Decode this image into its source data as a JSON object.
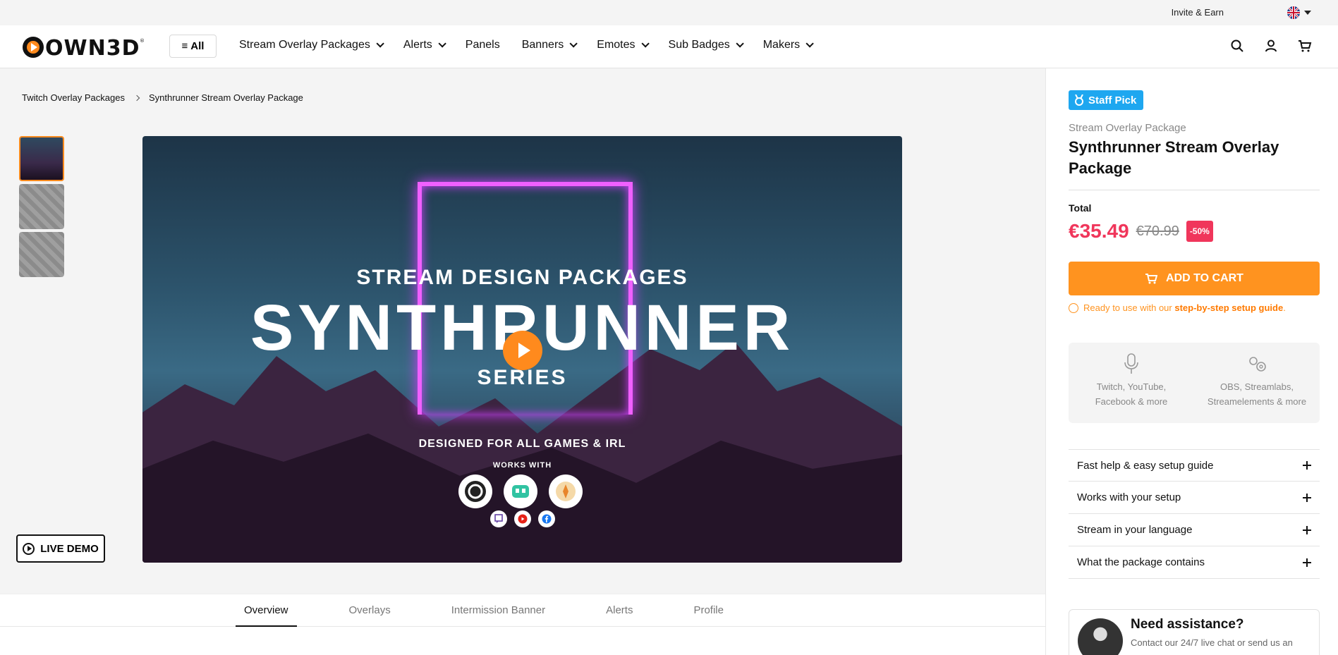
{
  "topbar": {
    "invite_label": "Invite & Earn",
    "language_icon": "uk-flag-icon"
  },
  "header": {
    "logo_text": "OWN3D",
    "all_label": "All",
    "nav": [
      {
        "label": "Stream Overlay Packages",
        "has_dropdown": true
      },
      {
        "label": "Alerts",
        "has_dropdown": true
      },
      {
        "label": "Panels",
        "has_dropdown": false
      },
      {
        "label": "Banners",
        "has_dropdown": true
      },
      {
        "label": "Emotes",
        "has_dropdown": true
      },
      {
        "label": "Sub Badges",
        "has_dropdown": true
      },
      {
        "label": "Makers",
        "has_dropdown": true
      }
    ],
    "icons": [
      "search-icon",
      "account-icon",
      "cart-icon"
    ]
  },
  "breadcrumb": {
    "parent": "Twitch Overlay Packages",
    "current": "Synthrunner Stream Overlay Package"
  },
  "hero": {
    "line1": "STREAM DESIGN PACKAGES",
    "title": "SYNTHRUNNER",
    "line2": "SERIES",
    "designed": "DESIGNED FOR ALL GAMES & IRL",
    "works_with": "WORKS WITH"
  },
  "live_demo_label": "LIVE DEMO",
  "tabs": [
    "Overview",
    "Overlays",
    "Intermission Banner",
    "Alerts",
    "Profile"
  ],
  "product": {
    "badge": "Staff Pick",
    "category": "Stream Overlay Package",
    "title": "Synthrunner Stream Overlay Package",
    "total_label": "Total",
    "price_now": "€35.49",
    "price_old": "€70.99",
    "discount": "-50%",
    "add_to_cart": "ADD TO CART",
    "ready_prefix": "Ready to use with our ",
    "ready_link": "step-by-step setup guide",
    "ready_suffix": ".",
    "compat": [
      {
        "icon": "microphone-icon",
        "line1": "Twitch, YouTube,",
        "line2": "Facebook & more"
      },
      {
        "icon": "gears-icon",
        "line1": "OBS, Streamlabs,",
        "line2": "Streamelements & more"
      }
    ],
    "accordion": [
      "Fast help & easy setup guide",
      "Works with your setup",
      "Stream in your language",
      "What the package contains"
    ],
    "assist_title": "Need assistance?",
    "assist_text": "Contact our 24/7 live chat or send us an"
  },
  "colors": {
    "accent": "#ff931f",
    "price": "#f0365b",
    "badge": "#1ea7f0"
  }
}
